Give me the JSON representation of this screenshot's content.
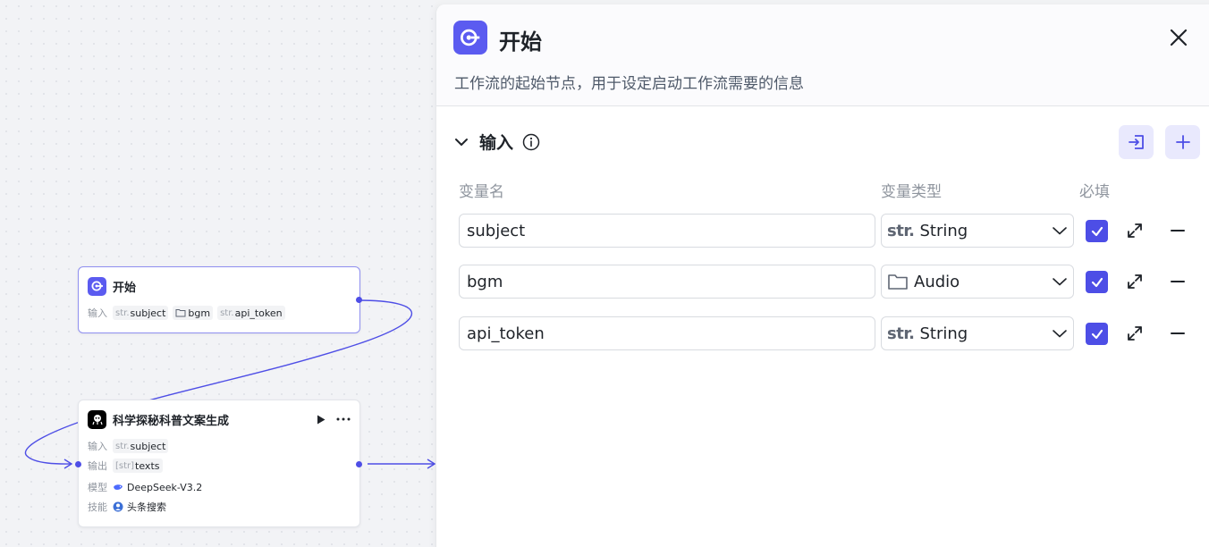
{
  "canvas": {
    "start_node": {
      "title": "开始",
      "input_label": "输入",
      "inputs": [
        {
          "prefix": "str.",
          "name": "subject"
        },
        {
          "prefix": "",
          "name": "bgm",
          "icon": "folder-icon"
        },
        {
          "prefix": "str.",
          "name": "api_token"
        }
      ]
    },
    "agent_node": {
      "title": "科学探秘科普文案生成",
      "input_label": "输入",
      "input_value": {
        "prefix": "str.",
        "name": "subject"
      },
      "output_label": "输出",
      "output_value": {
        "prefix": "[str]",
        "name": "texts"
      },
      "model_label": "模型",
      "model_value": "DeepSeek-V3.2",
      "skill_label": "技能",
      "skill_value": "头条搜索"
    }
  },
  "panel": {
    "title": "开始",
    "description": "工作流的起始节点，用于设定启动工作流需要的信息",
    "section_title": "输入",
    "columns": {
      "name": "变量名",
      "type": "变量类型",
      "required": "必填"
    },
    "rows": [
      {
        "name": "subject",
        "type_prefix": "str.",
        "type": "String",
        "required": true
      },
      {
        "name": "bgm",
        "type_prefix": "",
        "type": "Audio",
        "type_icon": "folder-icon",
        "required": true
      },
      {
        "name": "api_token",
        "type_prefix": "str.",
        "type": "String",
        "required": true
      }
    ]
  },
  "colors": {
    "accent": "#4d4ee6",
    "accent_light": "#e9e9fd",
    "border": "#d8dbe0"
  }
}
